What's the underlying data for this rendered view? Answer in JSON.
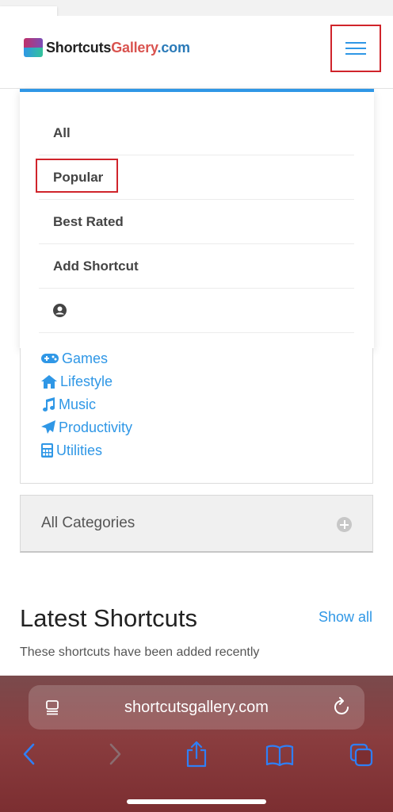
{
  "brand": {
    "logo_part1": "Shortcuts",
    "logo_part2": "Gallery",
    "logo_part3": ".com"
  },
  "menu": {
    "items": [
      {
        "label": "All"
      },
      {
        "label": "Popular"
      },
      {
        "label": "Best Rated"
      },
      {
        "label": "Add Shortcut"
      }
    ],
    "account_icon": "user-circle-icon"
  },
  "categories": {
    "links": [
      {
        "label": "Games",
        "icon": "gamepad-icon"
      },
      {
        "label": "Lifestyle",
        "icon": "home-icon"
      },
      {
        "label": "Music",
        "icon": "music-note-icon"
      },
      {
        "label": "Productivity",
        "icon": "paper-plane-icon"
      },
      {
        "label": "Utilities",
        "icon": "calculator-icon"
      }
    ],
    "all_label": "All Categories"
  },
  "latest": {
    "title": "Latest Shortcuts",
    "show_all": "Show all",
    "subtitle": "These shortcuts have been added recently"
  },
  "browser": {
    "url": "shortcutsgallery.com"
  },
  "colors": {
    "accent": "#2f97e6",
    "highlight": "#d0242b"
  }
}
